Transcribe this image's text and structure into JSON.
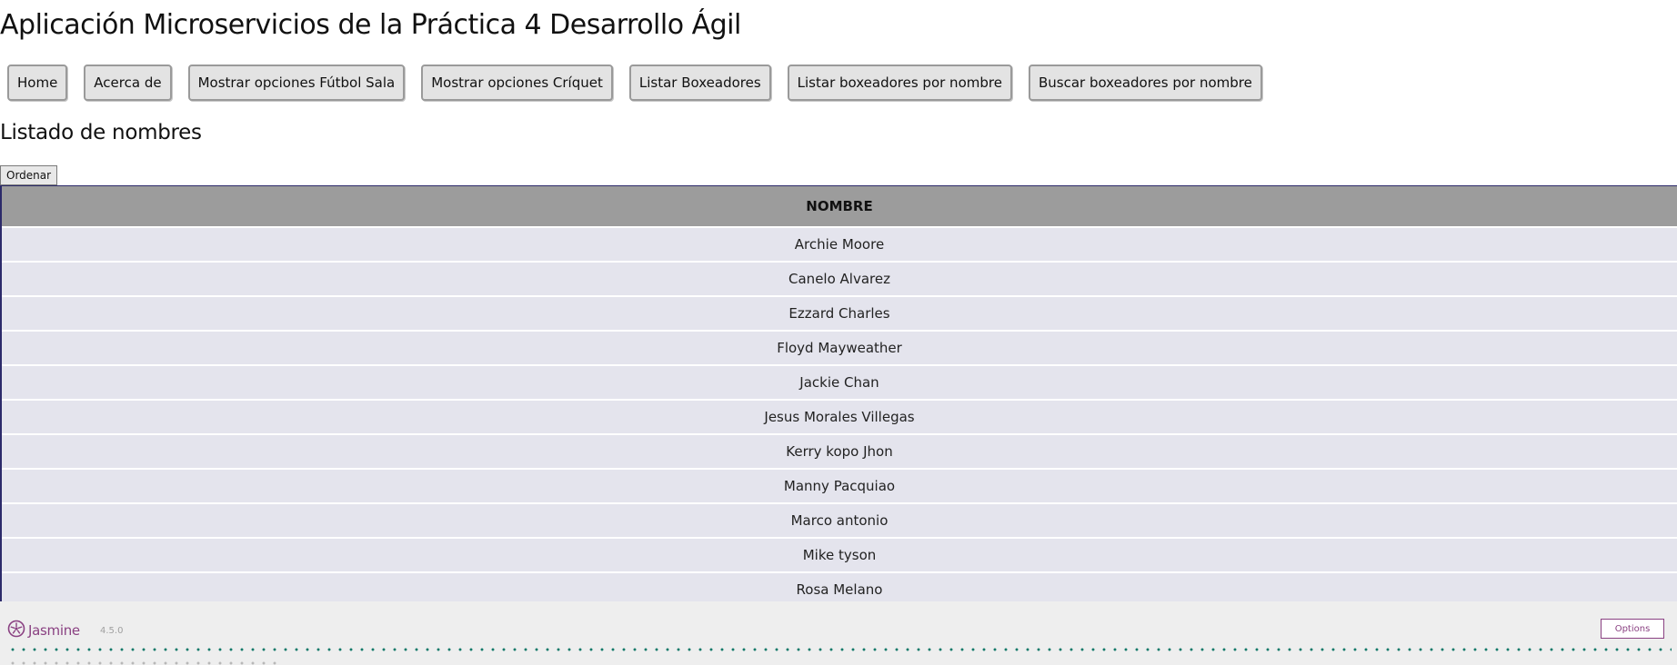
{
  "app": {
    "title": "Aplicación Microservicios de la Práctica 4 Desarrollo Ágil",
    "nav": [
      "Home",
      "Acerca de",
      "Mostrar opciones Fútbol Sala",
      "Mostrar opciones Críquet",
      "Listar Boxeadores",
      "Listar boxeadores por nombre",
      "Buscar boxeadores por nombre"
    ],
    "section_title": "Listado de nombres",
    "sort_label": "Ordenar",
    "table": {
      "header": "NOMBRE",
      "rows": [
        "Archie Moore",
        "Canelo Alvarez",
        "Ezzard Charles",
        "Floyd Mayweather",
        "Jackie Chan",
        "Jesus Morales Villegas",
        "Kerry kopo Jhon",
        "Manny Pacquiao",
        "Marco antonio",
        "Mike tyson",
        "Rosa Melano"
      ]
    }
  },
  "jasmine": {
    "name": "Jasmine",
    "version": "4.5.0",
    "options_label": "Options",
    "accent_color": "#8a4182",
    "dot_color": "#147a6a"
  }
}
